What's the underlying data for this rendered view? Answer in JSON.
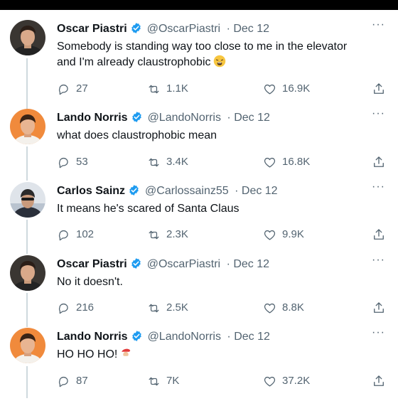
{
  "tweets": [
    {
      "name": "Oscar Piastri",
      "handle": "@OscarPiastri",
      "date": "· Dec 12",
      "text_line1": "Somebody is standing way too close to me in the elevator",
      "text_line2": "and I'm already claustrophobic",
      "replies": "27",
      "retweets": "1.1K",
      "likes": "16.9K",
      "avatar_icon": "oscar-avatar",
      "emoji": "weary-face-emoji"
    },
    {
      "name": "Lando Norris",
      "handle": "@LandoNorris",
      "date": "· Dec 12",
      "text_line1": "what does claustrophobic mean",
      "replies": "53",
      "retweets": "3.4K",
      "likes": "16.8K",
      "avatar_icon": "lando-avatar"
    },
    {
      "name": "Carlos Sainz",
      "handle": "@Carlossainz55",
      "date": "· Dec 12",
      "text_line1": "It means he's scared of Santa Claus",
      "replies": "102",
      "retweets": "2.3K",
      "likes": "9.9K",
      "avatar_icon": "carlos-avatar"
    },
    {
      "name": "Oscar Piastri",
      "handle": "@OscarPiastri",
      "date": "· Dec 12",
      "text_line1": "No it doesn't.",
      "replies": "216",
      "retweets": "2.5K",
      "likes": "8.8K",
      "avatar_icon": "oscar-avatar"
    },
    {
      "name": "Lando Norris",
      "handle": "@LandoNorris",
      "date": "· Dec 12",
      "text_line1": "HO HO HO!",
      "replies": "87",
      "retweets": "7K",
      "likes": "37.2K",
      "avatar_icon": "lando-avatar",
      "emoji": "santa-emoji"
    }
  ],
  "more_label": "···",
  "colors": {
    "verified": "#1d9bf0",
    "secondary_text": "#536471",
    "thread_line": "#cfd9de"
  }
}
